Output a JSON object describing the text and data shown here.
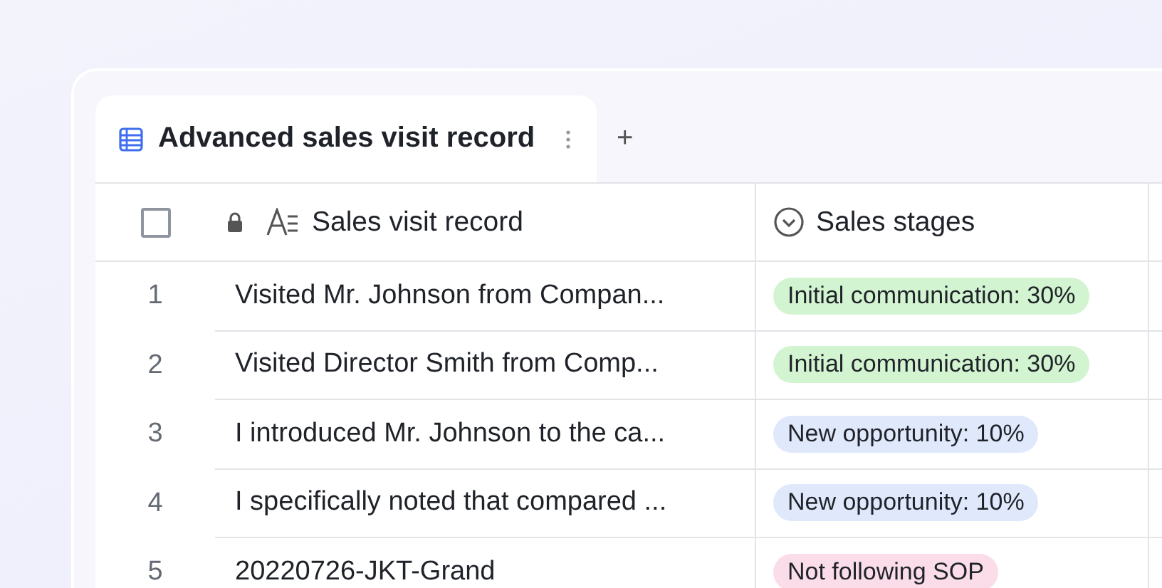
{
  "tabs": [
    {
      "label": "Advanced sales visit record",
      "selected": true
    }
  ],
  "add_tab": "+",
  "table": {
    "select_all_checked": false,
    "columns": [
      {
        "label": "Sales visit record",
        "kind": "text",
        "locked": true
      },
      {
        "label": "Sales stages",
        "kind": "select",
        "locked": false
      }
    ],
    "rows": [
      {
        "number": "1",
        "record": "Visited Mr. Johnson from Compan...",
        "stage": {
          "label": "Initial communication: 30%",
          "color": "#d3f4d0"
        }
      },
      {
        "number": "2",
        "record": "Visited Director Smith from Comp...",
        "stage": {
          "label": "Initial communication: 30%",
          "color": "#d3f4d0"
        }
      },
      {
        "number": "3",
        "record": "I introduced Mr. Johnson to the ca...",
        "stage": {
          "label": "New opportunity: 10%",
          "color": "#e0e8fc"
        }
      },
      {
        "number": "4",
        "record": "I specifically noted that compared ...",
        "stage": {
          "label": "New opportunity: 10%",
          "color": "#e0e8fc"
        }
      },
      {
        "number": "5",
        "record": "20220726-JKT-Grand",
        "stage": {
          "label": "Not following SOP",
          "color": "#fbdde9"
        }
      }
    ]
  }
}
